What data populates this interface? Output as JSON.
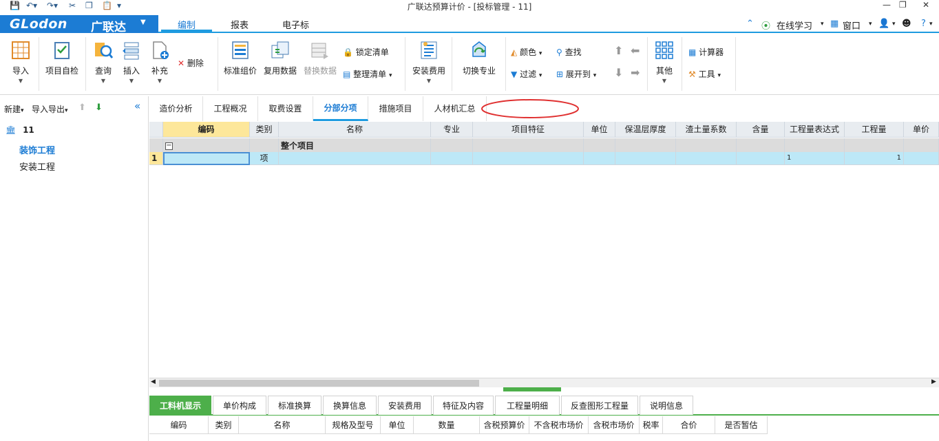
{
  "window": {
    "title": "广联达预算计价 - [投标管理 - 11]"
  },
  "menubar": {
    "brand": "GLodon",
    "brand_cn": "广联达",
    "tabs": [
      {
        "label": "编制",
        "active": true
      },
      {
        "label": "报表",
        "active": false
      },
      {
        "label": "电子标",
        "active": false
      }
    ],
    "online_learning": "在线学习",
    "window_menu": "窗口"
  },
  "ribbon": {
    "import": "导入",
    "self_check": "项目自检",
    "query": "查询",
    "insert": "插入",
    "supplement": "补充",
    "delete": "删除",
    "standard_pricing": "标准组价",
    "reuse_data": "复用数据",
    "replace_data": "替换数据",
    "lock_list": "锁定清单",
    "organize_list": "整理清单",
    "install_fee": "安装费用",
    "switch_major": "切换专业",
    "color": "颜色",
    "find": "查找",
    "filter": "过滤",
    "expand_to": "展开到",
    "other": "其他",
    "calculator": "计算器",
    "tools": "工具"
  },
  "left_panel": {
    "new": "新建",
    "import_export": "导入导出",
    "project_name": "11",
    "items": [
      {
        "label": "装饰工程",
        "selected": true
      },
      {
        "label": "安装工程",
        "selected": false
      }
    ]
  },
  "main_tabs": [
    {
      "label": "造价分析",
      "active": false
    },
    {
      "label": "工程概况",
      "active": false
    },
    {
      "label": "取费设置",
      "active": false
    },
    {
      "label": "分部分项",
      "active": true
    },
    {
      "label": "措施项目",
      "active": false
    },
    {
      "label": "人材机汇总",
      "active": false
    }
  ],
  "grid": {
    "columns": [
      "编码",
      "类别",
      "名称",
      "专业",
      "项目特征",
      "单位",
      "保温层厚度",
      "渣土量系数",
      "含量",
      "工程量表达式",
      "工程量",
      "单价"
    ],
    "group_row": {
      "toggle": "−",
      "name": "整个项目"
    },
    "rows": [
      {
        "num": "1",
        "code": "",
        "type": "项",
        "name": "",
        "major": "",
        "feature": "",
        "unit": "",
        "thickness": "",
        "coef": "",
        "content": "",
        "qty_expr": "1",
        "qty": "1",
        "price": ""
      }
    ]
  },
  "bottom_tabs": [
    {
      "label": "工料机显示",
      "active": true
    },
    {
      "label": "单价构成",
      "active": false
    },
    {
      "label": "标准换算",
      "active": false
    },
    {
      "label": "换算信息",
      "active": false
    },
    {
      "label": "安装费用",
      "active": false
    },
    {
      "label": "特征及内容",
      "active": false
    },
    {
      "label": "工程量明细",
      "active": false
    },
    {
      "label": "反查图形工程量",
      "active": false
    },
    {
      "label": "说明信息",
      "active": false
    }
  ],
  "bottom_grid": {
    "columns": [
      "编码",
      "类别",
      "名称",
      "规格及型号",
      "单位",
      "数量",
      "含税预算价",
      "不含税市场价",
      "含税市场价",
      "税率",
      "合价",
      "是否暂估"
    ]
  },
  "colors": {
    "brand_blue": "#1c7cd4",
    "accent_blue": "#1e9be0",
    "green_tab": "#4daf4a",
    "selected_row": "#bde8f7",
    "header_selected": "#fde79a",
    "annotation_red": "#e03030"
  }
}
